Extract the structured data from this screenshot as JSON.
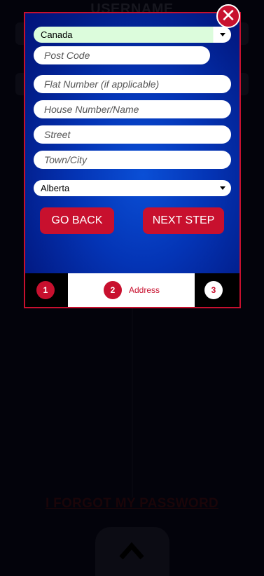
{
  "background": {
    "heading": "USERNAME",
    "forgot_link": "I FORGOT MY PASSWORD"
  },
  "modal": {
    "close_icon": "close-icon",
    "country_select": {
      "value": "Canada"
    },
    "post_code": {
      "placeholder": "Post Code"
    },
    "flat_number": {
      "placeholder": "Flat Number (if applicable)"
    },
    "house_number": {
      "placeholder": "House Number/Name"
    },
    "street": {
      "placeholder": "Street"
    },
    "town": {
      "placeholder": "Town/City"
    },
    "province_select": {
      "value": "Alberta"
    },
    "buttons": {
      "back": "GO BACK",
      "next": "NEXT STEP"
    },
    "steps": [
      {
        "number": "1",
        "label": ""
      },
      {
        "number": "2",
        "label": "Address"
      },
      {
        "number": "3",
        "label": ""
      }
    ]
  },
  "colors": {
    "accent": "#c8102e",
    "panel_blue": "#0434b5",
    "page_bg": "#03030b"
  }
}
